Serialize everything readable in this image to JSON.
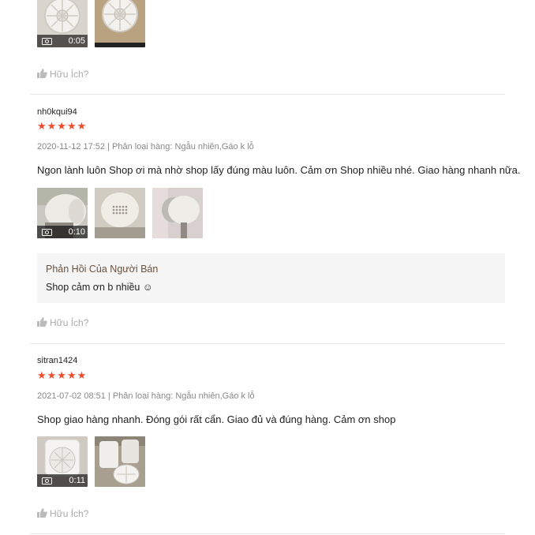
{
  "top_review": {
    "media": [
      {
        "type": "video",
        "duration": "0:05"
      },
      {
        "type": "image"
      }
    ],
    "helpful_label": "Hữu Ích?"
  },
  "reviews": [
    {
      "username": "nh0kqui94",
      "rating": 5,
      "stars": "★★★★★",
      "meta": "2020-11-12 17:52 | Phân loại hàng: Ngẫu nhiên,Gáo k lỗ",
      "content": "Ngon lành luôn Shop ơi mà nhờ shop lấy đúng màu luôn. Cảm ơn Shop nhiều nhé. Giao hàng nhanh nữa.",
      "media": [
        {
          "type": "video",
          "duration": "0:10"
        },
        {
          "type": "image"
        },
        {
          "type": "image"
        }
      ],
      "seller_reply": {
        "title": "Phản Hồi Của Người Bán",
        "text": "Shop cảm ơn b nhiều ☺"
      },
      "helpful_label": "Hữu Ích?"
    },
    {
      "username": "sitran1424",
      "rating": 5,
      "stars": "★★★★★",
      "meta": "2021-07-02 08:51 | Phân loại hàng: Ngẫu nhiên,Gáo k lỗ",
      "content": "Shop giao hàng nhanh. Đóng gói rất cẩn. Giao đủ và đúng hàng. Cảm ơn shop",
      "media": [
        {
          "type": "video",
          "duration": "0:11"
        },
        {
          "type": "image"
        }
      ],
      "helpful_label": "Hữu Ích?"
    }
  ],
  "colors": {
    "star": "#ee4d2d",
    "seller_title": "#6b5240",
    "seller_bg": "#f5f5f5",
    "divider": "#e8e8e8"
  }
}
